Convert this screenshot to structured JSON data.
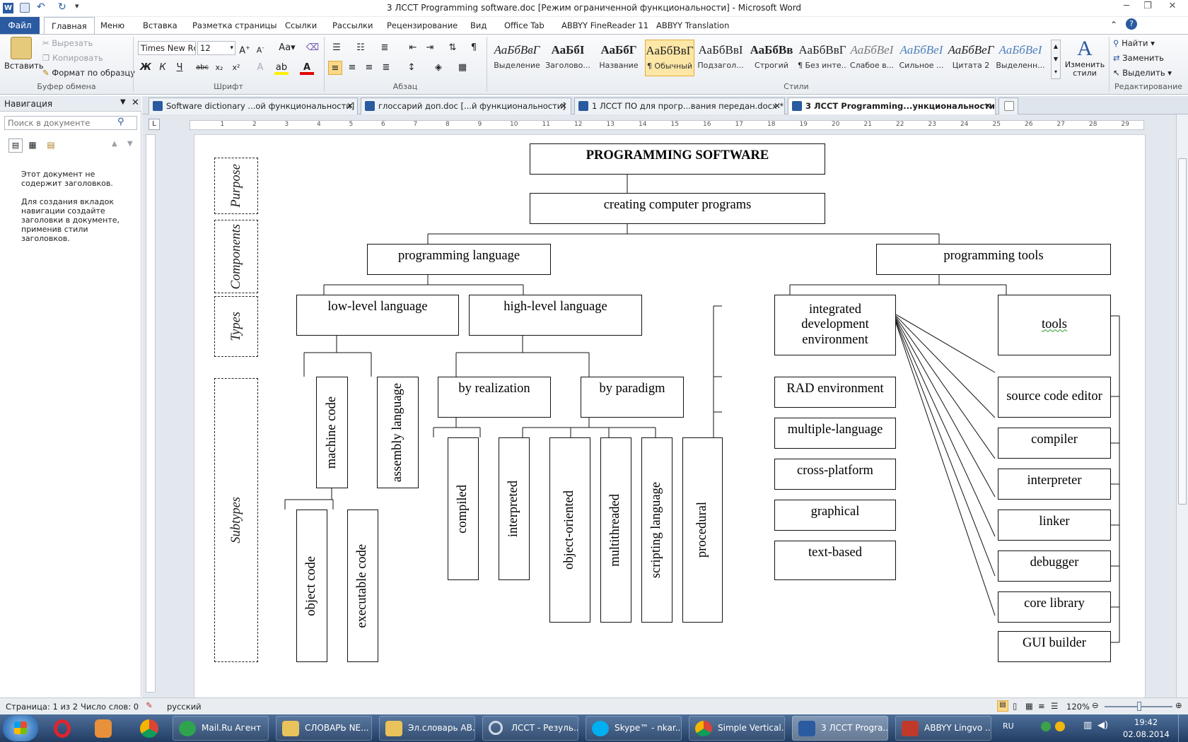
{
  "window": {
    "title": "3 ЛССТ Programming software.doc [Режим ограниченной функциональности] - Microsoft Word"
  },
  "ribbon_tabs": [
    "Файл",
    "Главная",
    "Меню",
    "Вставка",
    "Разметка страницы",
    "Ссылки",
    "Рассылки",
    "Рецензирование",
    "Вид",
    "Office Tab",
    "ABBYY FineReader 11",
    "ABBYY Translation"
  ],
  "clipboard": {
    "paste": "Вставить",
    "cut": "Вырезать",
    "copy": "Копировать",
    "format": "Формат по образцу",
    "label": "Буфер обмена"
  },
  "font": {
    "name": "Times New Rc",
    "size": "12",
    "label": "Шрифт",
    "bold": "Ж",
    "italic": "К",
    "underline": "Ч",
    "strike": "abc",
    "sub": "x₂",
    "sup": "x²"
  },
  "paragraph": {
    "label": "Абзац",
    "pilcrow": "¶"
  },
  "styles": {
    "label": "Стили",
    "items": [
      {
        "preview": "АаБбВвГ",
        "name": "Выделение"
      },
      {
        "preview": "АаБбI",
        "name": "Заголово..."
      },
      {
        "preview": "АаБбГ",
        "name": "Название"
      },
      {
        "preview": "АаБбВвГ",
        "name": "¶ Обычный"
      },
      {
        "preview": "АаБбВвІ",
        "name": "Подзагол..."
      },
      {
        "preview": "АаБбВв",
        "name": "Строгий"
      },
      {
        "preview": "АаБбВвГ",
        "name": "¶ Без инте..."
      },
      {
        "preview": "АаБбВеІ",
        "name": "Слабое в..."
      },
      {
        "preview": "АаБбВеІ",
        "name": "Сильное ..."
      },
      {
        "preview": "АаБбВеГ",
        "name": "Цитата 2"
      },
      {
        "preview": "АаБбВеІ",
        "name": "Выделенн..."
      }
    ],
    "change": "Изменить стили"
  },
  "editing": {
    "find": "Найти",
    "replace": "Заменить",
    "select": "Выделить",
    "label": "Редактирование"
  },
  "nav": {
    "title": "Навигация",
    "search_placeholder": "Поиск в документе",
    "msg1": "Этот документ не содержит заголовков.",
    "msg2": "Для создания вкладок навигации создайте заголовки в документе, применив стили заголовков."
  },
  "doc_tabs": [
    "Software dictionary ...ой функциональности]",
    "глоссарий доп.doc [...й функциональности]",
    "1 ЛССТ ПО для прогр...вания передан.docx *",
    "3 ЛССТ Programming...ункциональности] *"
  ],
  "diagram": {
    "row_labels": [
      "Purpose",
      "Components",
      "Types",
      "Subtypes"
    ],
    "title": "PROGRAMMING SOFTWARE",
    "purpose": "creating computer programs",
    "language": "programming language",
    "tools_group": "programming tools",
    "low": "low-level language",
    "high": "high-level language",
    "ide": "integrated development environment",
    "tools": "tools",
    "machine": "machine code",
    "assembly": "assembly language",
    "by_realization": "by realization",
    "by_paradigm": "by paradigm",
    "object_code": "object code",
    "executable": "executable code",
    "compiled": "compiled",
    "interpreted": "interpreted",
    "oop": "object-oriented",
    "multithreaded": "multithreaded",
    "scripting": "scripting language",
    "procedural": "procedural",
    "ide_types": [
      "RAD environment",
      "multiple-language",
      "cross-platform",
      "graphical",
      "text-based"
    ],
    "tool_types": [
      "source code editor",
      "compiler",
      "interpreter",
      "linker",
      "debugger",
      "core library",
      "GUI builder"
    ]
  },
  "status": {
    "page": "Страница: 1 из 2",
    "words": "Число слов: 0",
    "lang": "русский",
    "zoom": "120%"
  },
  "taskbar": {
    "items": [
      "Mail.Ru Агент",
      "СЛОВАРЬ NE...",
      "Эл.словарь АВ...",
      "ЛССТ - Резуль...",
      "Skype™ - nkar...",
      "Simple Vertical...",
      "3 ЛССТ Progra...",
      "ABBYY Lingvo ..."
    ],
    "lang": "RU",
    "time": "19:42",
    "date": "02.08.2014"
  }
}
